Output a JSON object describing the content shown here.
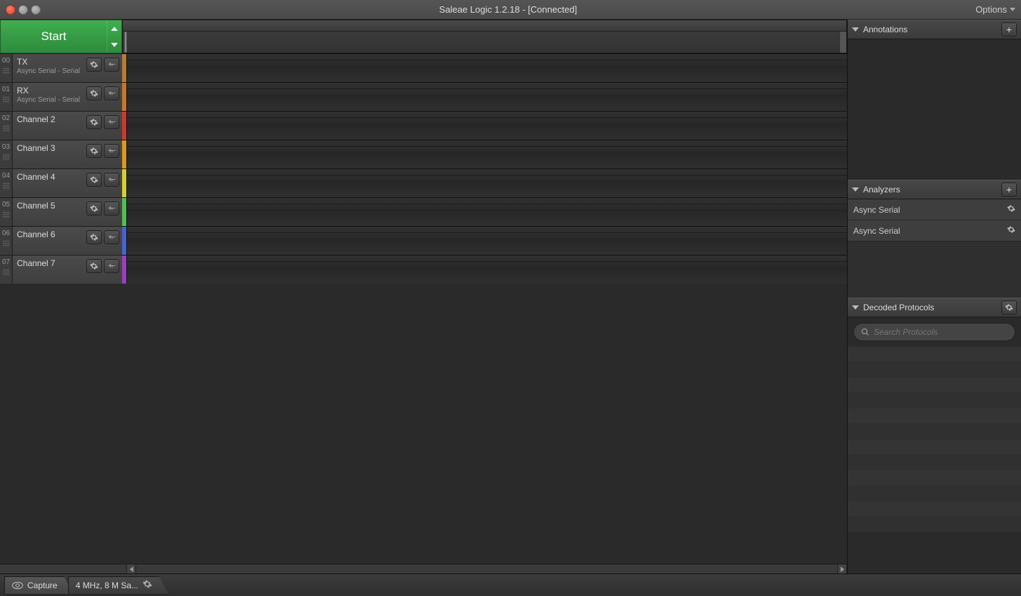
{
  "titlebar": {
    "title": "Saleae Logic 1.2.18 - [Connected]",
    "options_label": "Options"
  },
  "start_button": {
    "label": "Start"
  },
  "channels": [
    {
      "index": "00",
      "name": "TX",
      "sub": "Async Serial - Serial",
      "color": "#b97a34"
    },
    {
      "index": "01",
      "name": "RX",
      "sub": "Async Serial - Serial",
      "color": "#c9762a"
    },
    {
      "index": "02",
      "name": "Channel 2",
      "sub": "",
      "color": "#c83a2d"
    },
    {
      "index": "03",
      "name": "Channel 3",
      "sub": "",
      "color": "#d99a1e"
    },
    {
      "index": "04",
      "name": "Channel 4",
      "sub": "",
      "color": "#d6cf2e"
    },
    {
      "index": "05",
      "name": "Channel 5",
      "sub": "",
      "color": "#4fbf4f"
    },
    {
      "index": "06",
      "name": "Channel 6",
      "sub": "",
      "color": "#4763cf"
    },
    {
      "index": "07",
      "name": "Channel 7",
      "sub": "",
      "color": "#9a3fbf"
    }
  ],
  "panels": {
    "annotations": {
      "title": "Annotations"
    },
    "analyzers": {
      "title": "Analyzers",
      "items": [
        "Async Serial",
        "Async Serial"
      ]
    },
    "decoded": {
      "title": "Decoded Protocols",
      "search_placeholder": "Search Protocols"
    }
  },
  "bottombar": {
    "capture_tab": "Capture",
    "settings_tab": "4 MHz, 8 M Sa..."
  }
}
